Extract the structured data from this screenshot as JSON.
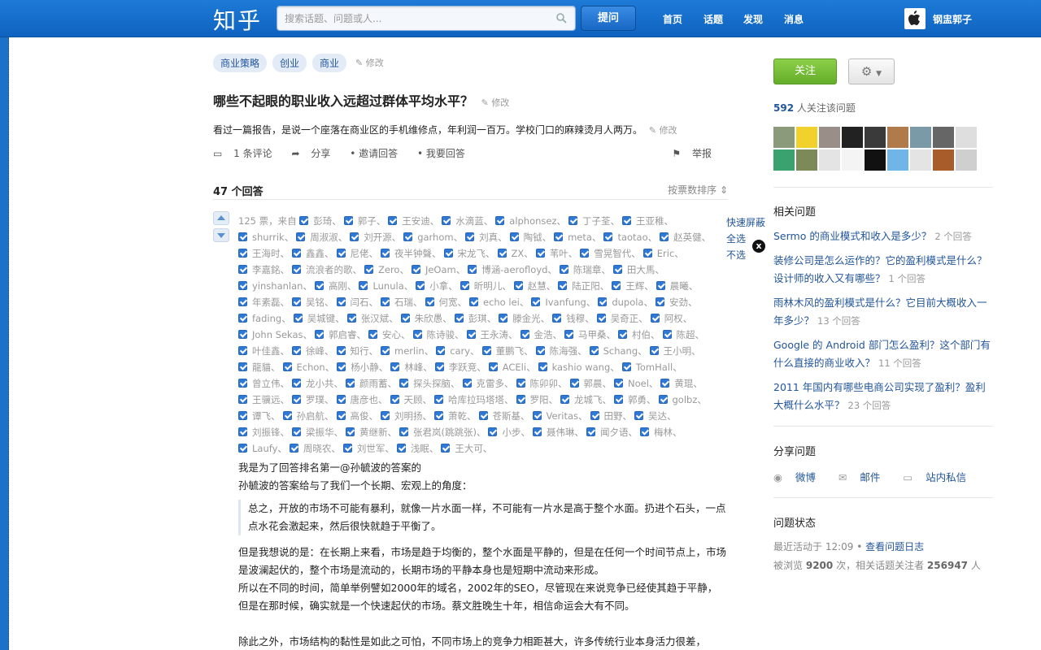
{
  "header": {
    "logo": "知乎",
    "search_placeholder": "搜索话题、问题或人...",
    "ask_label": "提问",
    "nav": [
      "首页",
      "话题",
      "发现",
      "消息"
    ],
    "user": "钢盅郭子"
  },
  "question": {
    "tags": [
      "商业策略",
      "创业",
      "商业"
    ],
    "edit_label": "修改",
    "title": "哪些不起眼的职业收入远超过群体平均水平？",
    "description": "看过一篇报告，是说一个座落在商业区的手机维修点，年利润一百万。学校门口的麻辣烫月人两万。",
    "actions": [
      "1 条评论",
      "分享",
      "邀请回答",
      "我要回答"
    ],
    "report_label": "举报"
  },
  "answers": {
    "count_label": "47 个回答",
    "sort_label": "按票数排序",
    "vote_prefix": "125 票，来自",
    "voters": [
      "彭琦",
      "郭子",
      "王安迪",
      "水滴蓝",
      "alphonsez",
      "丁子荃",
      "王亚稚",
      "shurrik",
      "周淑淑",
      "刘开源",
      "garhom",
      "刘真",
      "陶钺",
      "meta",
      "taotao",
      "赵英健",
      "王海时",
      "鑫鑫",
      "尼佬",
      "夜半钟聲",
      "宋龙飞",
      "ZX",
      "苇叶",
      "雪晃智代",
      "Eric",
      "李嘉銘",
      "流浪者的歌",
      "Zero",
      "JeOam",
      "博涵-aerofloyd",
      "陈瑞章",
      "田大馬",
      "yinshanlan",
      "高刚",
      "Lunula",
      "小拿",
      "昕明儿",
      "赵慧",
      "陆正阳",
      "王辉",
      "晨曦",
      "年素磊",
      "吴铭",
      "闫石",
      "石瑞",
      "何宽",
      "echo lei",
      "Ivanfung",
      "dupola",
      "安劲",
      "fading",
      "吴城键",
      "张汉斌",
      "朱欣愚",
      "彭琪",
      "滕金光",
      "钱穆",
      "吴奇正",
      "阿权",
      "John Sekas",
      "郭启睿",
      "安心",
      "陈诗骏",
      "王永涛",
      "金浩",
      "马甲桑",
      "村伯",
      "陈超",
      "叶佳鑫",
      "徐峰",
      "知行",
      "merlin",
      "cary",
      "董鹏飞",
      "陈海强",
      "Schang",
      "王小明",
      "龍貓",
      "Echon",
      "杨小静",
      "林峰",
      "李跃竞",
      "ACEli",
      "kashio wang",
      "TomHall",
      "曾立伟",
      "龙小共",
      "颜雨蓄",
      "探头探脑",
      "克雷多",
      "陈卯卯",
      "郭晨",
      "Noel",
      "黄琨",
      "王骥远",
      "罗璞",
      "唐彦也",
      "天顾",
      "哈库拉玛塔塔",
      "罗阳",
      "龙城飞",
      "郭勇",
      "golbz",
      "谭飞",
      "孙启航",
      "高俊",
      "刘明扬",
      "萧乾",
      "苍斯基",
      "Veritas",
      "田野",
      "吴达",
      "刘振锋",
      "梁振华",
      "黄继新",
      "张君岚(跳跳张)",
      "小步",
      "聂伟琳",
      "闻夕语",
      "梅林",
      "Laufy",
      "周晓农",
      "刘世军",
      "浅眠",
      "王大可"
    ],
    "quick_actions": [
      "快速屏蔽",
      "全选",
      "不选"
    ],
    "close_icon": "x",
    "answer_body": {
      "line1": "我是为了回答排名第一@孙毓波的答案的",
      "line2": "孙毓波的答案给与了我们一个长期、宏观上的角度：",
      "quote": "总之，开放的市场不可能有暴利，就像一片水面一样，不可能有一片水是高于整个水面。扔进个石头，一点点水花会激起来，然后很快就趋于平衡了。",
      "para1": "但是我想说的是：在长期上来看，市场是趋于均衡的，整个水面是平静的，但是在任何一个时间节点上，市场是波澜起伏的，整个市场是流动的，长期市场的平静本身也是短期中流动来形成。",
      "para2": "所以在不同的时间，简单举例譬如2000年的域名，2002年的SEO，尽管现在来说竞争已经使其趋于平静，但是在那时候，确实就是一个快速起伏的市场。蔡文胜晚生十年，相信命运会大有不同。",
      "para3": "除此之外，市场结构的黏性是如此之可怕，不同市场上的竞争力相距甚大，许多传统行业本身活力很差，"
    }
  },
  "sidebar": {
    "follow_label": "关注",
    "gear_icon": "gear-icon",
    "followers_count": "592",
    "followers_suffix": "人关注该问题",
    "related_title": "相关问题",
    "related": [
      {
        "q": "Sermo 的商业模式和收入是多少？",
        "c": "2 个回答"
      },
      {
        "q": "装修公司是怎么运作的？它的盈利模式是什么？设计师的收入又有哪些？",
        "c": "1 个回答"
      },
      {
        "q": "雨林木风的盈利模式是什么？它目前大概收入一年多少？",
        "c": "13 个回答"
      },
      {
        "q": "Google 的 Android 部门怎么盈利？这个部门有什么直接的商业收入？",
        "c": "11 个回答"
      },
      {
        "q": "2011 年国内有哪些电商公司实现了盈利？盈利大概什么水平？",
        "c": "23 个回答"
      }
    ],
    "share_title": "分享问题",
    "share": [
      "微博",
      "邮件",
      "站内私信"
    ],
    "status_title": "问题状态",
    "last_active_label": "最近活动于 12:09",
    "log_link": "查看问题日志",
    "views_prefix": "被浏览",
    "views": "9200",
    "views_mid": "次，相关话题关注者",
    "topic_followers": "256947",
    "views_suffix": "人"
  }
}
